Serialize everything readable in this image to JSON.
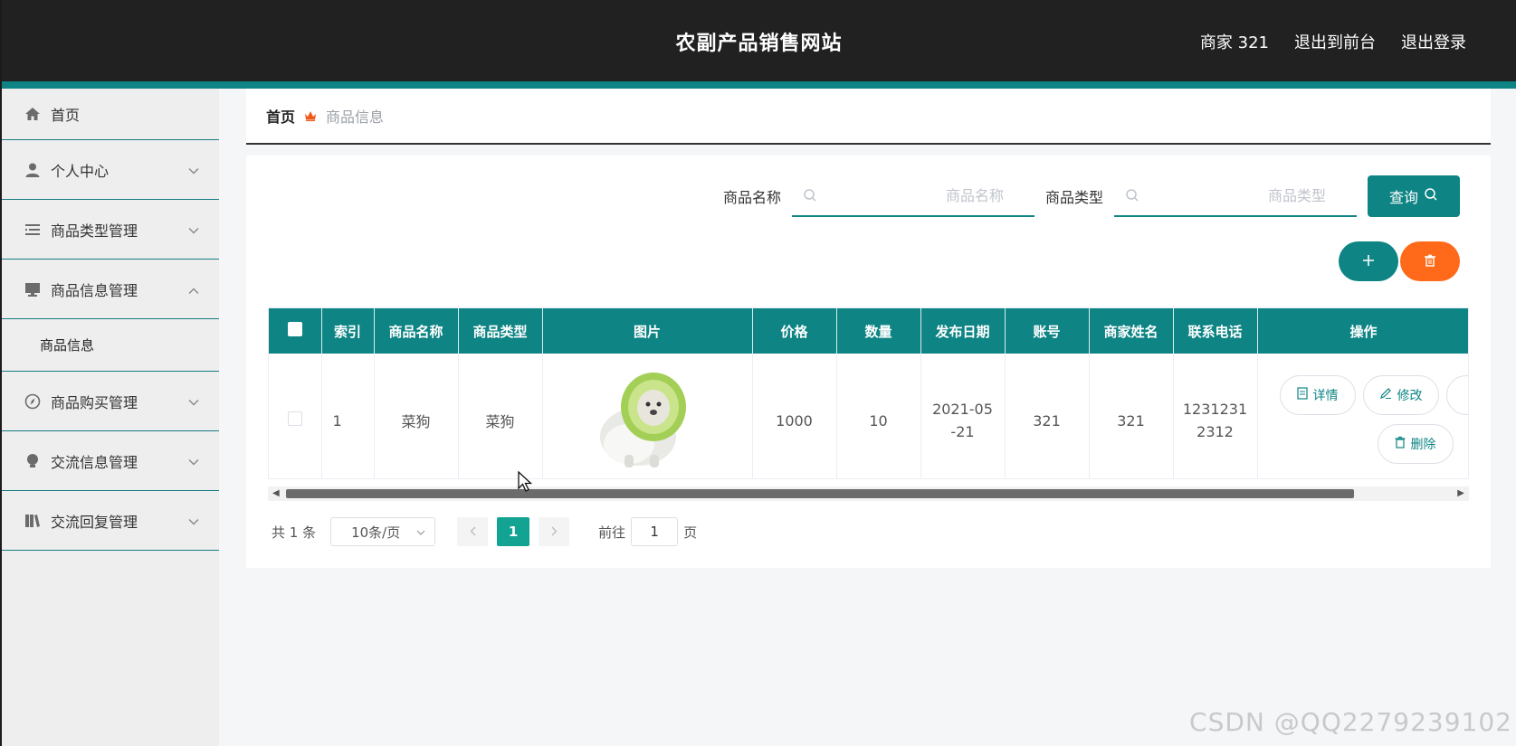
{
  "header": {
    "title": "农副产品销售网站",
    "user": "商家 321",
    "to_front": "退出到前台",
    "logout": "退出登录"
  },
  "sidebar": {
    "items": [
      {
        "label": "首页",
        "icon": "home-icon"
      },
      {
        "label": "个人中心",
        "icon": "user-icon"
      },
      {
        "label": "商品类型管理",
        "icon": "list-icon"
      },
      {
        "label": "商品信息管理",
        "icon": "monitor-icon"
      },
      {
        "label": "商品购买管理",
        "icon": "compass-icon"
      },
      {
        "label": "交流信息管理",
        "icon": "bulb-icon"
      },
      {
        "label": "交流回复管理",
        "icon": "book-icon"
      }
    ],
    "sub_item": "商品信息"
  },
  "breadcrumb": {
    "home": "首页",
    "current": "商品信息"
  },
  "search": {
    "name_label": "商品名称",
    "name_placeholder": "商品名称",
    "type_label": "商品类型",
    "type_placeholder": "商品类型",
    "query_label": "查询"
  },
  "table": {
    "columns": [
      "索引",
      "商品名称",
      "商品类型",
      "图片",
      "价格",
      "数量",
      "发布日期",
      "账号",
      "商家姓名",
      "联系电话",
      "操作"
    ],
    "rows": [
      {
        "index": "1",
        "name": "菜狗",
        "type": "菜狗",
        "price": "1000",
        "quantity": "10",
        "date_line1": "2021-05",
        "date_line2": "-21",
        "account": "321",
        "merchant": "321",
        "phone_line1": "1231231",
        "phone_line2": "2312"
      }
    ],
    "ops": {
      "detail": "详情",
      "edit": "修改",
      "delete": "删除"
    }
  },
  "pagination": {
    "total": "共 1 条",
    "page_size": "10条/页",
    "current": "1",
    "goto_label": "前往",
    "goto_value": "1",
    "page_suffix": "页"
  },
  "watermark": "CSDN @QQ2279239102",
  "colors": {
    "accent": "#0e8484",
    "danger": "#ff6a1a",
    "header_bg": "#212121",
    "active_page": "#12a393"
  }
}
